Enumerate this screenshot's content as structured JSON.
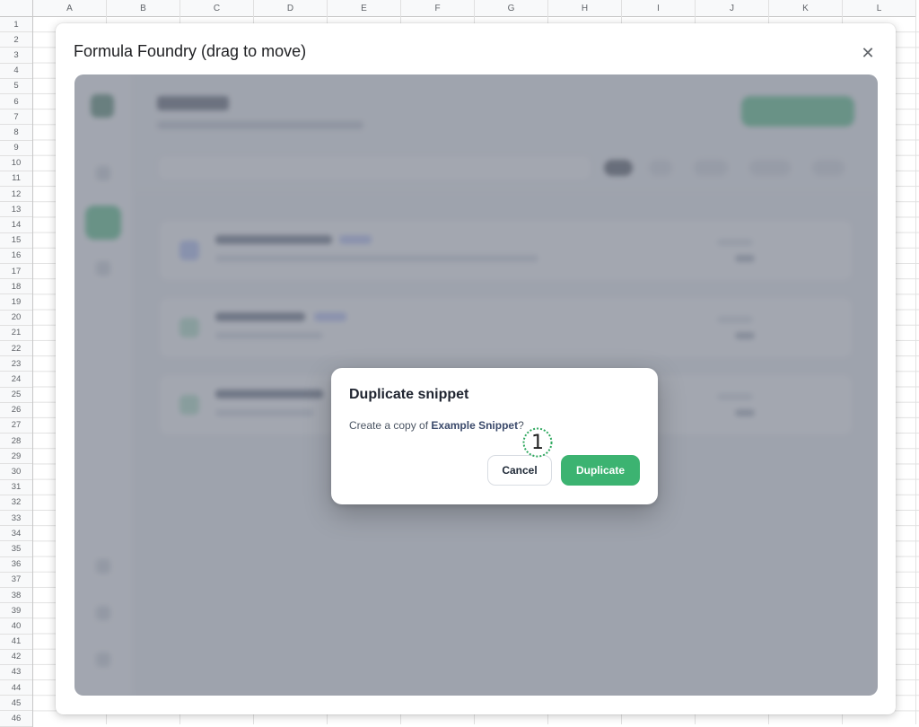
{
  "sheet": {
    "columns": [
      "A",
      "B",
      "C",
      "D",
      "E",
      "F",
      "G",
      "H",
      "I",
      "J",
      "K",
      "L"
    ],
    "rows": [
      "1",
      "2",
      "3",
      "4",
      "5",
      "6",
      "7",
      "8",
      "9",
      "10",
      "11",
      "12",
      "13",
      "14",
      "15",
      "16",
      "17",
      "18",
      "19",
      "20",
      "21",
      "22",
      "23",
      "24",
      "25",
      "26",
      "27",
      "28",
      "29",
      "30",
      "31",
      "32",
      "33",
      "34",
      "35",
      "36",
      "37",
      "38",
      "39",
      "40",
      "41",
      "42",
      "43",
      "44",
      "45",
      "46"
    ]
  },
  "window": {
    "title": "Formula Foundry (drag to move)",
    "close_icon": "close-icon"
  },
  "dialog": {
    "title": "Duplicate snippet",
    "text_prefix": "Create a copy of ",
    "snippet_name": "Example Snippet",
    "text_suffix": "?",
    "cancel_label": "Cancel",
    "duplicate_label": "Duplicate"
  },
  "marker": {
    "label": "1"
  },
  "colors": {
    "accent": "#3cb371",
    "overlay": "#808592"
  }
}
